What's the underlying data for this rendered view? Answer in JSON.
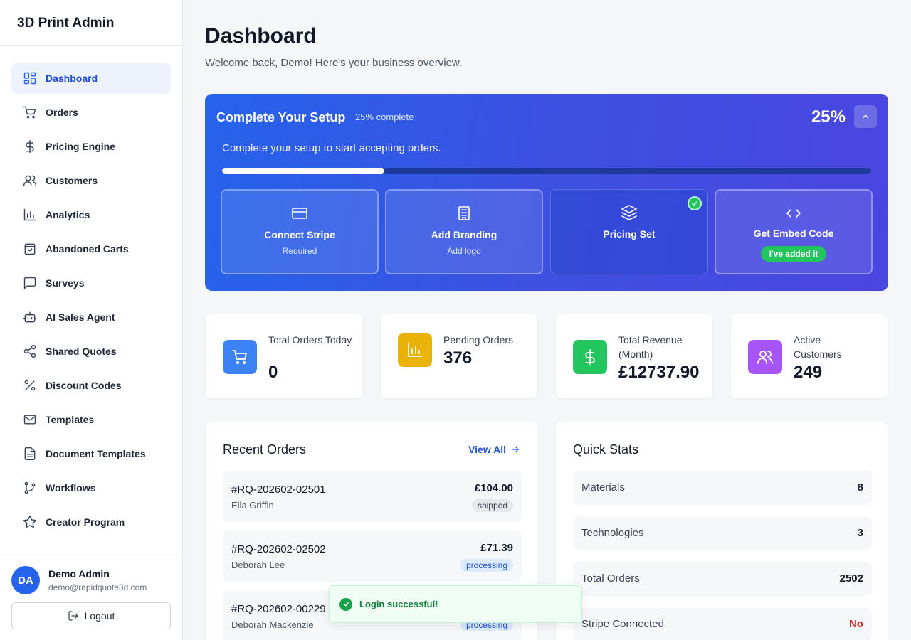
{
  "app": {
    "brand": "3D Print Admin"
  },
  "sidebar": {
    "items": [
      {
        "label": "Dashboard",
        "icon": "dashboard-icon"
      },
      {
        "label": "Orders",
        "icon": "cart-icon"
      },
      {
        "label": "Pricing Engine",
        "icon": "dollar-icon"
      },
      {
        "label": "Customers",
        "icon": "users-icon"
      },
      {
        "label": "Analytics",
        "icon": "bar-chart-icon"
      },
      {
        "label": "Abandoned Carts",
        "icon": "bag-icon"
      },
      {
        "label": "Surveys",
        "icon": "message-square-icon"
      },
      {
        "label": "AI Sales Agent",
        "icon": "bot-icon"
      },
      {
        "label": "Shared Quotes",
        "icon": "share-icon"
      },
      {
        "label": "Discount Codes",
        "icon": "percent-icon"
      },
      {
        "label": "Templates",
        "icon": "mail-icon"
      },
      {
        "label": "Document Templates",
        "icon": "file-text-icon"
      },
      {
        "label": "Workflows",
        "icon": "git-branch-icon"
      },
      {
        "label": "Creator Program",
        "icon": "star-icon"
      }
    ],
    "active_index": 0,
    "user": {
      "initials": "DA",
      "name": "Demo Admin",
      "email": "demo@rapidquote3d.com"
    },
    "logout_label": "Logout"
  },
  "header": {
    "title": "Dashboard",
    "subtitle": "Welcome back, Demo! Here's your business overview."
  },
  "setup": {
    "title": "Complete Your Setup",
    "complete_text": "25% complete",
    "percent_label": "25%",
    "progress_fraction": 0.25,
    "description": "Complete your setup to start accepting orders.",
    "steps": [
      {
        "name": "Connect Stripe",
        "sub": "Required",
        "icon": "credit-card-icon",
        "done": false
      },
      {
        "name": "Add Branding",
        "sub": "Add logo",
        "icon": "building-icon",
        "done": false
      },
      {
        "name": "Pricing Set",
        "sub": "",
        "icon": "layers-icon",
        "done": true
      },
      {
        "name": "Get Embed Code",
        "sub": "I've added it",
        "icon": "code-icon",
        "done": false
      }
    ]
  },
  "stats": [
    {
      "label": "Total Orders Today",
      "value": "0",
      "color": "#3b82f6",
      "icon": "cart-icon"
    },
    {
      "label": "Pending Orders",
      "value": "376",
      "color": "#eab308",
      "icon": "bar-chart-icon"
    },
    {
      "label": "Total Revenue (Month)",
      "value": "£12737.90",
      "color": "#22c55e",
      "icon": "dollar-icon"
    },
    {
      "label": "Active Customers",
      "value": "249",
      "color": "#a855f7",
      "icon": "users-icon"
    }
  ],
  "recent_orders": {
    "title": "Recent Orders",
    "view_all": "View All",
    "rows": [
      {
        "id": "#RQ-202602-02501",
        "customer": "Ella Griffin",
        "amount": "£104.00",
        "status": "shipped"
      },
      {
        "id": "#RQ-202602-02502",
        "customer": "Deborah Lee",
        "amount": "£71.39",
        "status": "processing"
      },
      {
        "id": "#RQ-202602-00229",
        "customer": "Deborah Mackenzie",
        "amount": "",
        "status": "processing"
      }
    ]
  },
  "quick_stats": {
    "title": "Quick Stats",
    "rows": [
      {
        "label": "Materials",
        "value": "8"
      },
      {
        "label": "Technologies",
        "value": "3"
      },
      {
        "label": "Total Orders",
        "value": "2502"
      },
      {
        "label": "Stripe Connected",
        "value": "No"
      }
    ]
  },
  "toast": {
    "message": "Login successful!",
    "icon": "check-circle-icon"
  }
}
